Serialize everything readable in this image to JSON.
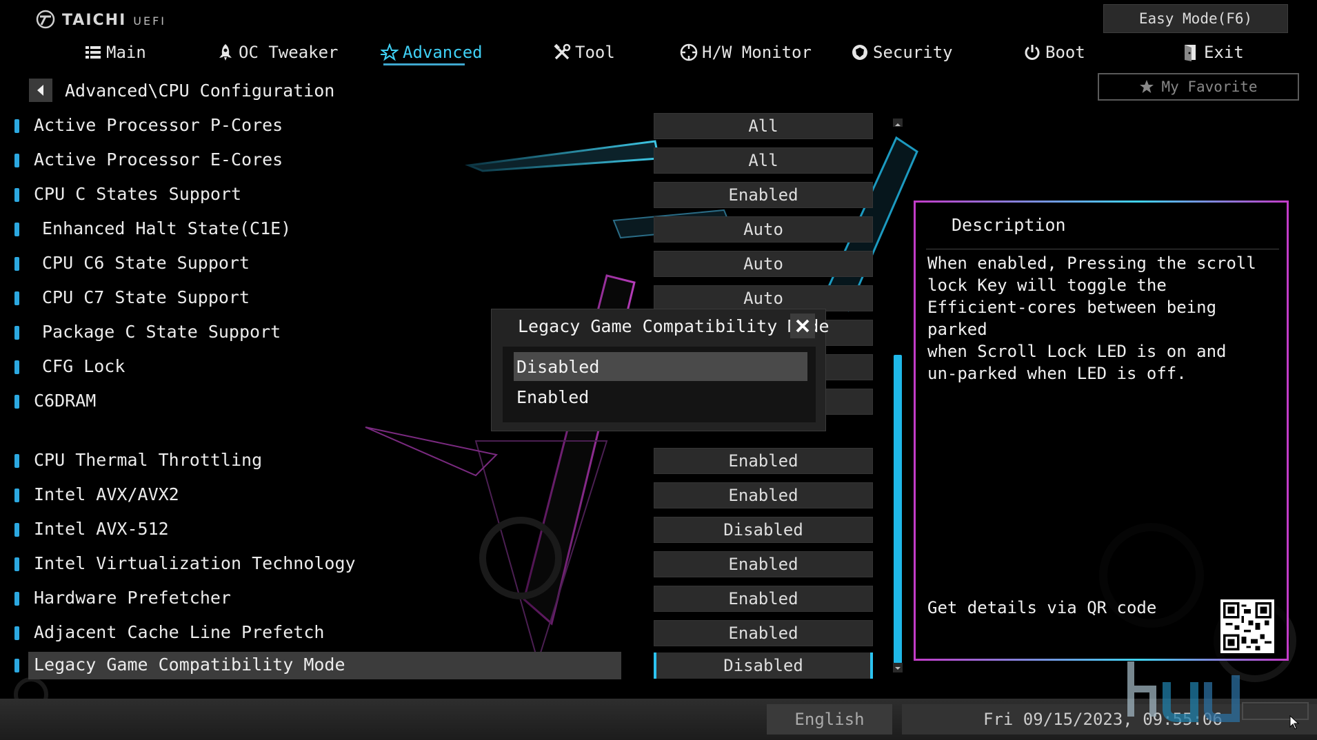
{
  "brand": {
    "name": "TAICHI",
    "sub": "UEFI"
  },
  "header": {
    "easy_mode": "Easy Mode(F6)",
    "my_favorite": "My Favorite"
  },
  "nav": [
    {
      "label": "Main",
      "icon": "list-icon",
      "active": false
    },
    {
      "label": "OC Tweaker",
      "icon": "rocket-icon",
      "active": false
    },
    {
      "label": "Advanced",
      "icon": "star-icon",
      "active": true
    },
    {
      "label": "Tool",
      "icon": "tools-icon",
      "active": false
    },
    {
      "label": "H/W Monitor",
      "icon": "monitor-gauge-icon",
      "active": false
    },
    {
      "label": "Security",
      "icon": "shield-icon",
      "active": false
    },
    {
      "label": "Boot",
      "icon": "power-icon",
      "active": false
    },
    {
      "label": "Exit",
      "icon": "exit-door-icon",
      "active": false
    }
  ],
  "breadcrumb": "Advanced\\CPU Configuration",
  "settings": [
    {
      "label": "Active Processor P-Cores",
      "value": "All"
    },
    {
      "label": "Active Processor E-Cores",
      "value": "All"
    },
    {
      "label": "CPU C States Support",
      "value": "Enabled"
    },
    {
      "label": "Enhanced Halt State(C1E)",
      "value": "Auto"
    },
    {
      "label": "CPU C6 State Support",
      "value": "Auto"
    },
    {
      "label": "CPU C7 State Support",
      "value": "Auto"
    },
    {
      "label": "Package C State Support",
      "value": ""
    },
    {
      "label": "CFG Lock",
      "value": ""
    },
    {
      "label": "C6DRAM",
      "value": ""
    },
    {
      "label": "CPU Thermal Throttling",
      "value": "Enabled"
    },
    {
      "label": "Intel AVX/AVX2",
      "value": "Enabled"
    },
    {
      "label": "Intel AVX-512",
      "value": "Disabled"
    },
    {
      "label": "Intel Virtualization Technology",
      "value": "Enabled"
    },
    {
      "label": "Hardware Prefetcher",
      "value": "Enabled"
    },
    {
      "label": "Adjacent Cache Line Prefetch",
      "value": "Enabled"
    },
    {
      "label": "Legacy Game Compatibility Mode",
      "value": "Disabled"
    }
  ],
  "dialog": {
    "title": "Legacy Game Compatibility Mode",
    "options": [
      "Disabled",
      "Enabled"
    ],
    "selected": "Disabled"
  },
  "description": {
    "title": "Description",
    "text": "When enabled, Pressing the scroll\nlock Key will toggle the\nEfficient-cores between being parked\nwhen Scroll Lock LED is on and\nun-parked when LED is off.",
    "qr_label": "Get details via QR code"
  },
  "footer": {
    "language": "English",
    "datetime": "Fri 09/15/2023, 09:55:06"
  },
  "colors": {
    "accent": "#2cc3f0",
    "panel_border_start": "#c23cc8",
    "panel_border_end": "#3fd4f2"
  }
}
